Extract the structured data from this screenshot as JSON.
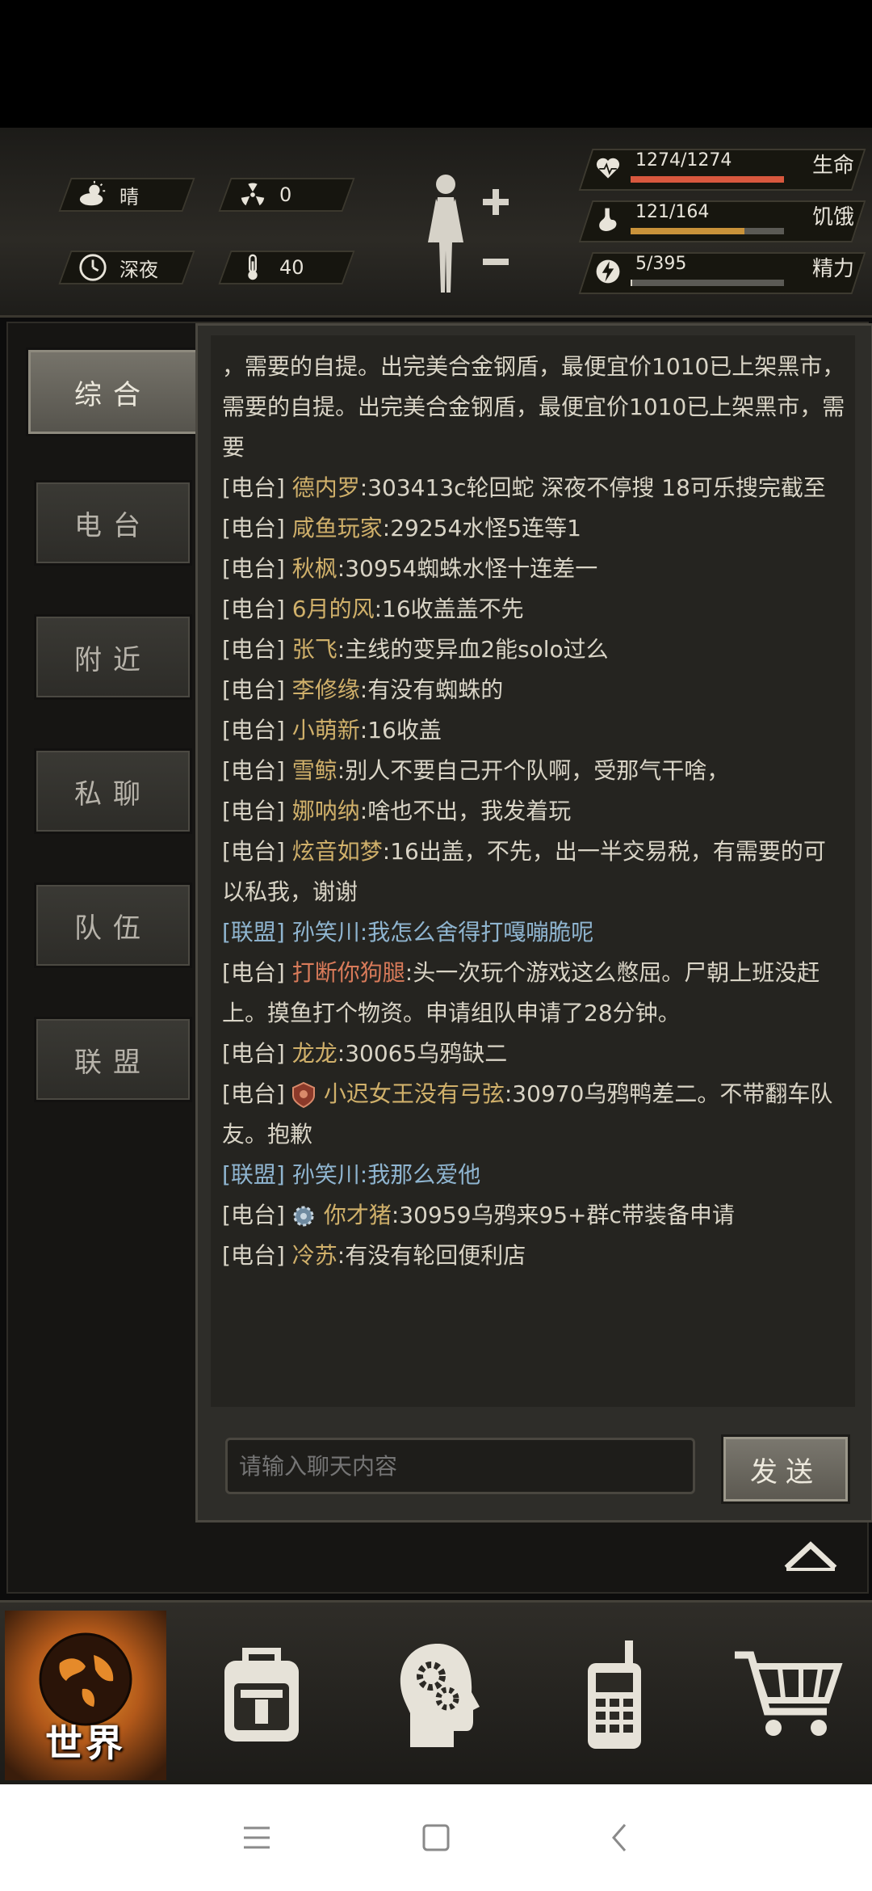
{
  "hud": {
    "weather": "晴",
    "radiation": "0",
    "time_of_day": "深夜",
    "temperature": "40",
    "stats": [
      {
        "name": "生命",
        "value": "1274/1274",
        "fill": 1.0,
        "color": "#d8583e",
        "icon": "heart-icon"
      },
      {
        "name": "饥饿",
        "value": "121/164",
        "fill": 0.74,
        "color": "#c9923a",
        "icon": "stomach-icon"
      },
      {
        "name": "精力",
        "value": "5/395",
        "fill": 0.013,
        "color": "#d9d5ca",
        "icon": "energy-icon"
      }
    ]
  },
  "tabs": [
    {
      "label": "综合",
      "active": true
    },
    {
      "label": "电台"
    },
    {
      "label": "附近"
    },
    {
      "label": "私聊"
    },
    {
      "label": "队伍"
    },
    {
      "label": "联盟"
    }
  ],
  "chat": {
    "messages": [
      {
        "channel": "",
        "user": "",
        "text": "，需要的自提。出完美合金钢盾，最便宜价1010已上架黑市，需要的自提。出完美合金钢盾，最便宜价1010已上架黑市，需要"
      },
      {
        "channel": "[电台]",
        "user": "德内罗",
        "text": ":303413c轮回蛇 深夜不停搜 18可乐搜完截至"
      },
      {
        "channel": "[电台]",
        "user": "咸鱼玩家",
        "text": ":29254水怪5连等1"
      },
      {
        "channel": "[电台]",
        "user": "秋枫",
        "text": ":30954蜘蛛水怪十连差一"
      },
      {
        "channel": "[电台]",
        "user": "6月的风",
        "text": ":16收盖盖不先"
      },
      {
        "channel": "[电台]",
        "user": "张飞",
        "text": ":主线的变异血2能solo过么"
      },
      {
        "channel": "[电台]",
        "user": "李修缘",
        "text": ":有没有蜘蛛的"
      },
      {
        "channel": "[电台]",
        "user": "小萌新",
        "text": ":16收盖"
      },
      {
        "channel": "[电台]",
        "user": "雪鲸",
        "text": ":别人不要自己开个队啊，受那气干啥，"
      },
      {
        "channel": "[电台]",
        "user": "娜呐纳",
        "text": ":啥也不出，我发着玩"
      },
      {
        "channel": "[电台]",
        "user": "炫音如梦",
        "text": ":16出盖，不先，出一半交易税，有需要的可以私我，谢谢"
      },
      {
        "channel": "[联盟]",
        "user": "孙笑川",
        "text": ":我怎么舍得打嘎嘣脆呢",
        "style": "union"
      },
      {
        "channel": "[电台]",
        "user": "打断你狗腿",
        "text": ":头一次玩个游戏这么憋屈。尸朝上班没赶上。摸鱼打个物资。申请组队申请了28分钟。",
        "user_style": "red"
      },
      {
        "channel": "[电台]",
        "user": "龙龙",
        "text": ":30065乌鸦缺二"
      },
      {
        "channel": "[电台]",
        "user": "小迟女王没有弓弦",
        "text": ":30970乌鸦鸭差二。不带翻车队友。抱歉",
        "badge": "red"
      },
      {
        "channel": "[联盟]",
        "user": "孙笑川",
        "text": ":我那么爱他",
        "style": "union"
      },
      {
        "channel": "[电台]",
        "user": "你才猪",
        "text": ":30959乌鸦来95+群c带装备申请",
        "badge": "gear"
      },
      {
        "channel": "[电台]",
        "user": "冷苏",
        "text": ":有没有轮回便利店"
      }
    ],
    "input_placeholder": "请输入聊天内容",
    "send_label": "发送"
  },
  "bottom_nav": {
    "world_label": "世界",
    "items": [
      "world-globe-icon",
      "backpack-icon",
      "skills-head-icon",
      "radio-walkie-icon",
      "shop-cart-icon"
    ]
  }
}
